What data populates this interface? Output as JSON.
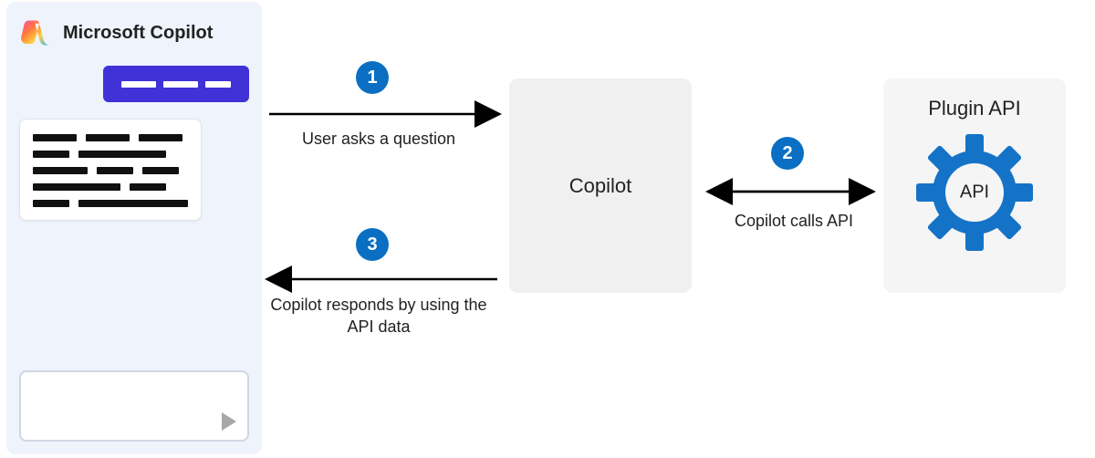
{
  "panel": {
    "title": "Microsoft Copilot"
  },
  "center": {
    "label": "Copilot"
  },
  "plugin": {
    "title": "Plugin API",
    "gear_text": "API"
  },
  "steps": {
    "s1": {
      "num": "1",
      "label": "User asks a question"
    },
    "s2": {
      "num": "2",
      "label": "Copilot calls API"
    },
    "s3": {
      "num": "3",
      "label": "Copilot responds by using the API data"
    }
  }
}
